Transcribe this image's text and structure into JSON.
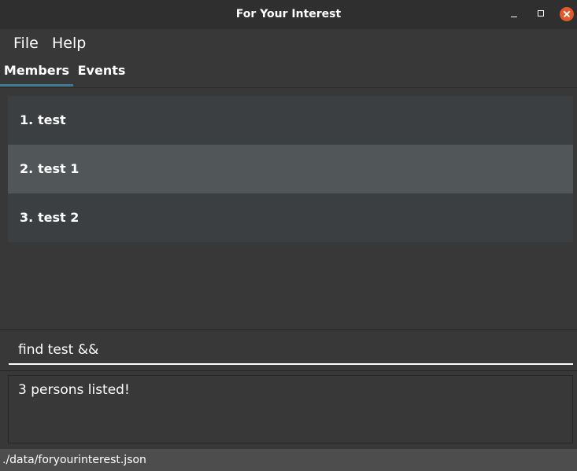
{
  "window": {
    "title": "For Your Interest",
    "close_color": "#e05a2b"
  },
  "menu": {
    "items": [
      {
        "label": "File"
      },
      {
        "label": "Help"
      }
    ]
  },
  "tabs": [
    {
      "label": "Members",
      "active": true
    },
    {
      "label": "Events",
      "active": false
    }
  ],
  "members": [
    {
      "index": "1.",
      "name": "test",
      "selected": false
    },
    {
      "index": "2.",
      "name": "test 1",
      "selected": true
    },
    {
      "index": "3.",
      "name": "test 2",
      "selected": false
    }
  ],
  "command": {
    "value": "find test &&"
  },
  "result": {
    "text": "3 persons listed!"
  },
  "status": {
    "path": "./data/foryourinterest.json"
  },
  "colors": {
    "accent": "#3e7b91",
    "selected_row": "#515658",
    "background": "#383838"
  }
}
